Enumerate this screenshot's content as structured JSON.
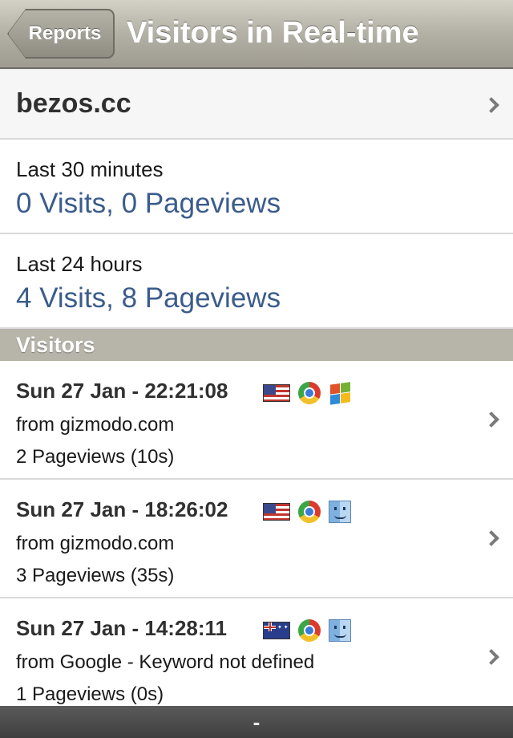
{
  "nav": {
    "back_label": "Reports",
    "title": "Visitors in Real-time"
  },
  "site": {
    "name": "bezos.cc"
  },
  "stats": [
    {
      "label": "Last 30 minutes",
      "value": "0 Visits, 0 Pageviews"
    },
    {
      "label": "Last 24 hours",
      "value": "4 Visits, 8 Pageviews"
    }
  ],
  "visitors_header": "Visitors",
  "visitors": [
    {
      "time": "Sun 27 Jan - 22:21:08",
      "source": "from gizmodo.com",
      "pageviews": "2 Pageviews (10s)",
      "country_icon": "us-flag-icon",
      "browser_icon": "chrome-icon",
      "os_icon": "windows-icon"
    },
    {
      "time": "Sun 27 Jan - 18:26:02",
      "source": "from gizmodo.com",
      "pageviews": "3 Pageviews (35s)",
      "country_icon": "us-flag-icon",
      "browser_icon": "chrome-icon",
      "os_icon": "mac-finder-icon"
    },
    {
      "time": "Sun 27 Jan - 14:28:11",
      "source": "from Google - Keyword not defined",
      "pageviews": "1 Pageviews (0s)",
      "country_icon": "australia-flag-icon",
      "browser_icon": "chrome-icon",
      "os_icon": "mac-finder-icon"
    }
  ],
  "bottom_bar": {
    "text": "-"
  },
  "colors": {
    "link_blue": "#3b5c8c",
    "section_header": "#b7b4aa",
    "navbar": "#b3b0a5"
  }
}
